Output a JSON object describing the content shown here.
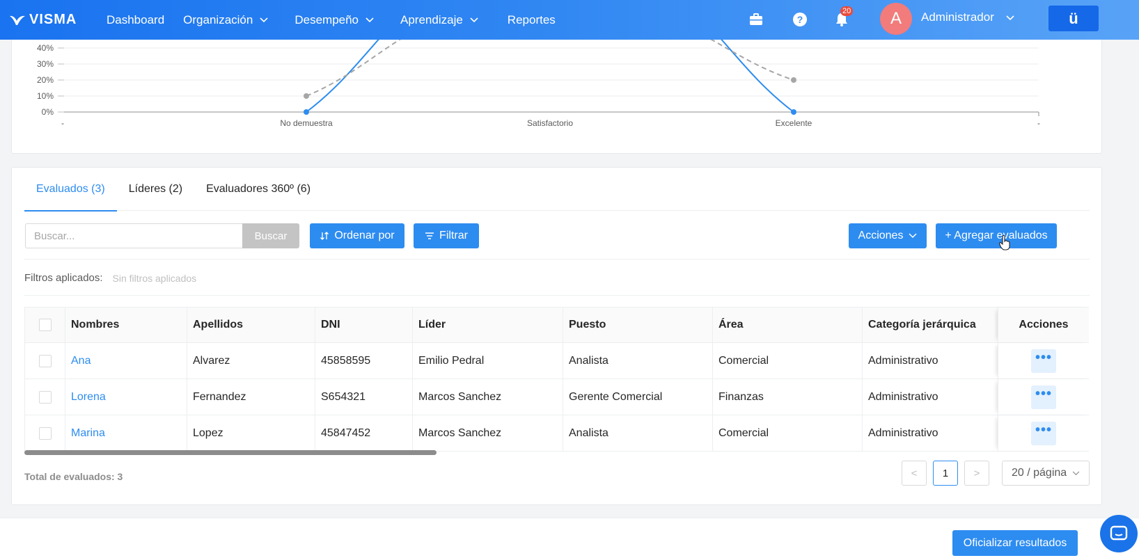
{
  "brand": {
    "name": "VISMA"
  },
  "nav": {
    "items": [
      {
        "label": "Dashboard",
        "has_dropdown": false
      },
      {
        "label": "Organización",
        "has_dropdown": true
      },
      {
        "label": "Desempeño",
        "has_dropdown": true
      },
      {
        "label": "Aprendizaje",
        "has_dropdown": true
      },
      {
        "label": "Reportes",
        "has_dropdown": false
      }
    ],
    "notifications_count": "20",
    "avatar_initial": "A",
    "user_name": "Administrador",
    "app_button_label": "ü"
  },
  "chart_data": {
    "type": "line",
    "categories": [
      "No demuestra",
      "Satisfactorio",
      "Excelente"
    ],
    "y_ticks": [
      "0%",
      "10%",
      "20%",
      "30%",
      "40%"
    ],
    "x_edge_ticks": [
      "-",
      "-"
    ],
    "series": [
      {
        "style": "solid",
        "color": "#2d8cf0",
        "values": [
          0,
          100,
          0
        ]
      },
      {
        "style": "dashed",
        "color": "#a6a6a6",
        "values": [
          10,
          70,
          20
        ]
      }
    ],
    "ylim_visible": [
      0,
      40
    ]
  },
  "tabs": [
    {
      "label": "Evaluados (3)",
      "active": true
    },
    {
      "label": "Líderes (2)",
      "active": false
    },
    {
      "label": "Evaluadores 360º (6)",
      "active": false
    }
  ],
  "toolbar": {
    "search_placeholder": "Buscar...",
    "search_button": "Buscar",
    "sort_button": "Ordenar por",
    "filter_button": "Filtrar",
    "actions_button": "Acciones",
    "add_button": "+ Agregar evaluados"
  },
  "filters": {
    "label": "Filtros aplicados:",
    "value": "Sin filtros aplicados"
  },
  "table": {
    "columns": [
      "Nombres",
      "Apellidos",
      "DNI",
      "Líder",
      "Puesto",
      "Área",
      "Categoría jerárquica",
      "Acciones"
    ],
    "rows": [
      {
        "nombres": "Ana",
        "apellidos": "Alvarez",
        "dni": "45858595",
        "lider": "Emilio Pedral",
        "puesto": "Analista",
        "area": "Comercial",
        "categoria": "Administrativo"
      },
      {
        "nombres": "Lorena",
        "apellidos": "Fernandez",
        "dni": "S654321",
        "lider": "Marcos Sanchez",
        "puesto": "Gerente Comercial",
        "area": "Finanzas",
        "categoria": "Administrativo"
      },
      {
        "nombres": "Marina",
        "apellidos": "Lopez",
        "dni": "45847452",
        "lider": "Marcos Sanchez",
        "puesto": "Analista",
        "area": "Comercial",
        "categoria": "Administrativo"
      }
    ],
    "more_label": "•••"
  },
  "pagination": {
    "total_label": "Total de evaluados: 3",
    "prev": "<",
    "current_page": "1",
    "next": ">",
    "page_size": "20 / página"
  },
  "footer": {
    "official_button": "Oficializar resultados"
  }
}
